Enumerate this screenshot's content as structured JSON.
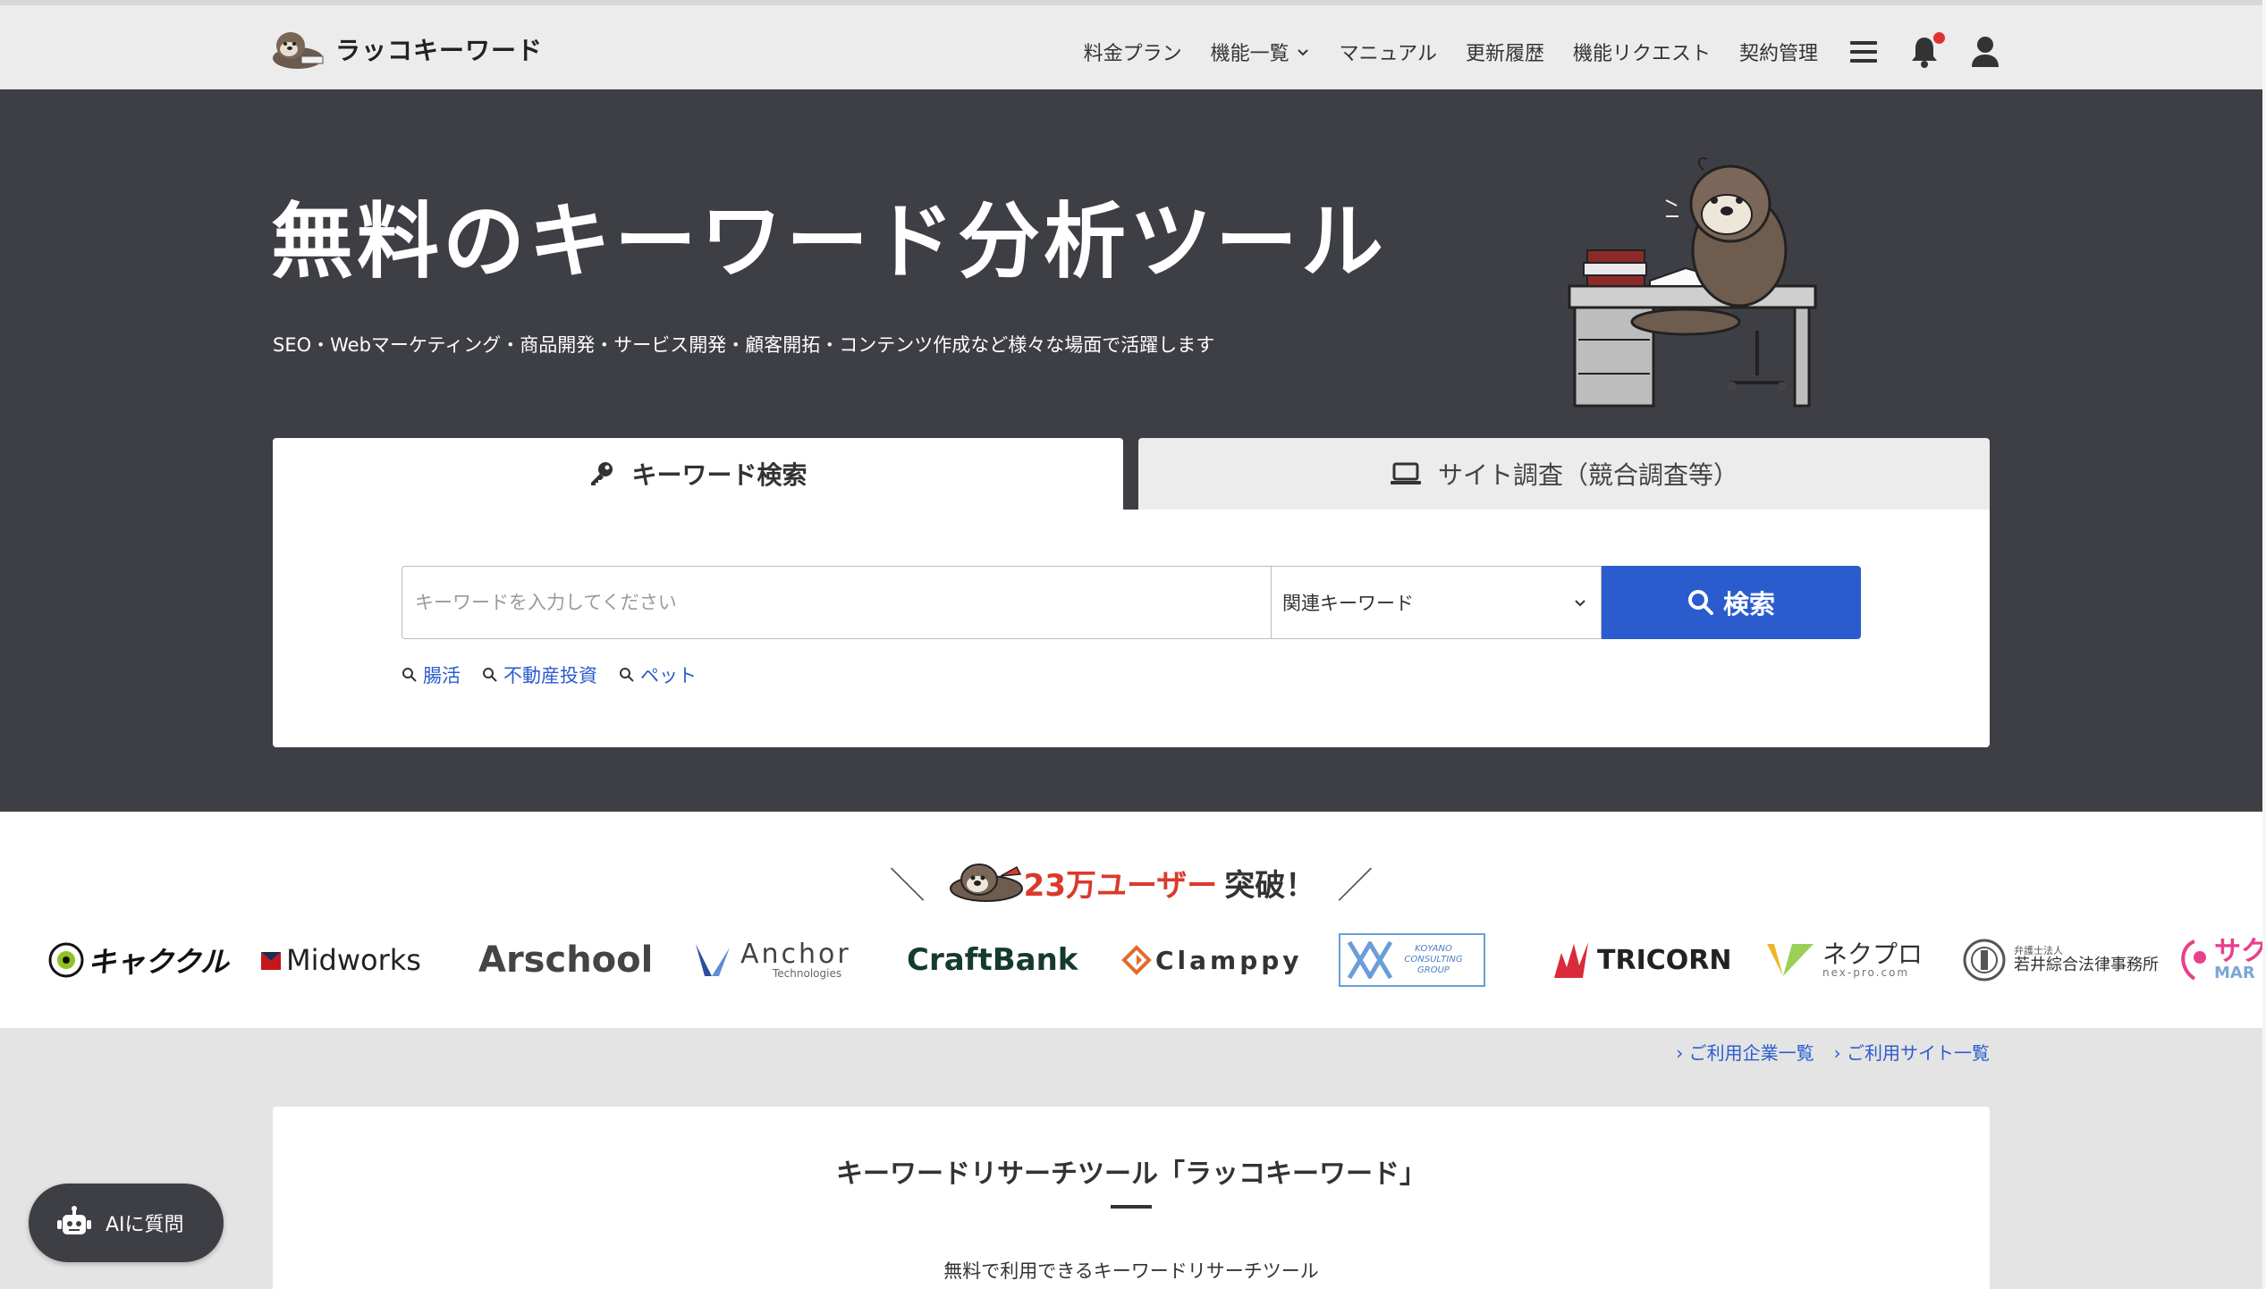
{
  "header": {
    "logo_text": "ラッコキーワード",
    "nav": {
      "pricing": "料金プラン",
      "features": "機能一覧",
      "manual": "マニュアル",
      "history": "更新履歴",
      "request": "機能リクエスト",
      "contract": "契約管理"
    }
  },
  "hero": {
    "title": "無料のキーワード分析ツール",
    "subtitle": "SEO・Webマーケティング・商品開発・サービス開発・顧客開拓・コンテンツ作成など様々な場面で活躍します",
    "tabs": {
      "keyword": "キーワード検索",
      "site": "サイト調査（競合調査等）"
    },
    "search": {
      "placeholder": "キーワードを入力してください",
      "mode": "関連キーワード",
      "button": "検索",
      "suggestions": [
        "腸活",
        "不動産投資",
        "ペット"
      ]
    }
  },
  "users": {
    "count_label": "23万ユーザー",
    "suffix": "突破！",
    "logos": {
      "kyakukuru": "キャククル",
      "midworks": "Midworks",
      "arschool": "Arschool",
      "anchor": "Anchor",
      "anchor_sub": "Technologies",
      "craftbank": "CraftBank",
      "clamppy": "Clamppy",
      "koyano": "KOYANO CONSULTING GROUP",
      "tricorn": "TRICORN",
      "nexpro": "ネクプロ",
      "nexpro_sub": "nex-pro.com",
      "wakai_small": "弁護士法人",
      "wakai": "若井綜合法律事務所",
      "sakura": "サク",
      "sakura_sub": "MAR"
    }
  },
  "links": {
    "companies": "ご利用企業一覧",
    "sites": "ご利用サイト一覧"
  },
  "about": {
    "title": "キーワードリサーチツール「ラッコキーワード」",
    "subtitle": "無料で利用できるキーワードリサーチツール"
  },
  "ai_button": "AIに質問",
  "colors": {
    "hero_bg": "#3e3f45",
    "accent_blue": "#2a5ccd",
    "highlight_red": "#d93a2b"
  }
}
